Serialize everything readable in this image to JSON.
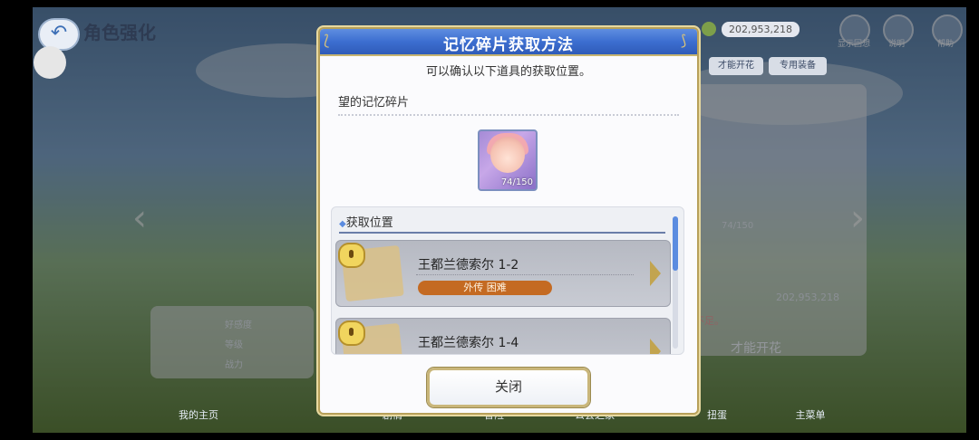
{
  "background": {
    "page_title": "角色强化",
    "mana_value": "202,953,218",
    "secondary_value": "202,953,218",
    "progress_text": "74/150",
    "top_icons": [
      "显示回想",
      "说明",
      "帮助"
    ],
    "tabs": [
      "才能开花",
      "专用装备"
    ],
    "stats": [
      "好感度",
      "等级",
      "战力"
    ],
    "bloom_button": "才能开花",
    "warning_text": "不足。",
    "bottom_tabs": [
      "我的主页",
      "剧情",
      "冒险",
      "公会之家",
      "扭蛋",
      "主菜单"
    ]
  },
  "dialog": {
    "title": "记忆碎片获取方法",
    "subtitle": "可以确认以下道具的获取位置。",
    "item_name": "望的记忆碎片",
    "item_count": "74/150",
    "section_header": "获取位置",
    "stages": [
      {
        "name": "王都兰德索尔 1-2",
        "tag": "外传 困难"
      },
      {
        "name": "王都兰德索尔 1-4",
        "tag": ""
      }
    ],
    "close_label": "关闭"
  },
  "colors": {
    "header_blue": "#3c6ed0",
    "tag_orange": "#c46a22",
    "frame_gold": "#b7a05a",
    "scrollbar_blue": "#5b8ce0"
  }
}
